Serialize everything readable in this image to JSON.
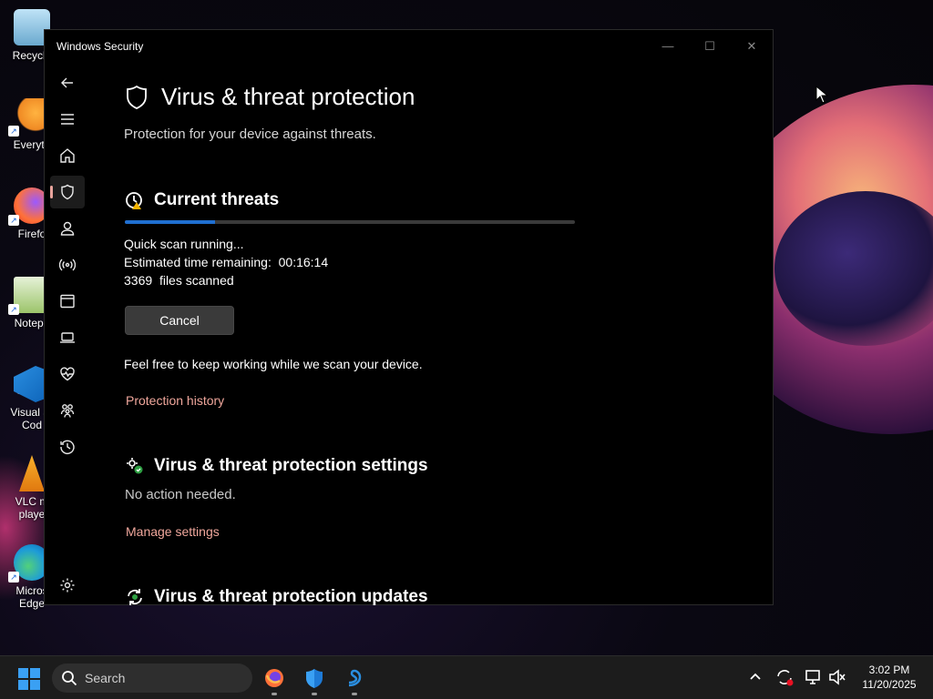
{
  "desktop": {
    "icons": [
      {
        "label": "Recycle",
        "color": "#8fc5e8"
      },
      {
        "label": "Everyth",
        "color": "#f08a24"
      },
      {
        "label": "Firefo",
        "color": "#ff7139"
      },
      {
        "label": "Notepa",
        "color": "#7bb04a"
      },
      {
        "label": "Visual St\nCod",
        "color": "#2a8ee0"
      },
      {
        "label": "VLC m\nplaye",
        "color": "#f29b1a"
      },
      {
        "label": "Micros\nEdge",
        "color": "#1d9bd8"
      }
    ]
  },
  "window": {
    "title": "Windows Security",
    "controls": {
      "minimize": "—",
      "maximize": "☐",
      "close": "✕"
    }
  },
  "sidebar": {
    "selected": "virus-threat",
    "accent": "#e9a59d"
  },
  "page": {
    "title": "Virus & threat protection",
    "subtitle": "Protection for your device against threats."
  },
  "current_threats": {
    "heading": "Current threats",
    "progress": 0.2,
    "status": "Quick scan running...",
    "eta_label": "Estimated time remaining:",
    "eta_value": "00:16:14",
    "files_count": "3369",
    "files_label": "files scanned",
    "cancel_label": "Cancel",
    "note": "Feel free to keep working while we scan your device.",
    "history_link": "Protection history"
  },
  "settings_section": {
    "heading": "Virus & threat protection settings",
    "status": "No action needed.",
    "manage_link": "Manage settings"
  },
  "updates_section": {
    "heading": "Virus & threat protection updates"
  },
  "taskbar": {
    "search_placeholder": "Search",
    "time": "3:02 PM",
    "date": "11/20/2025"
  },
  "colors": {
    "link": "#f0a79c",
    "progress_fill": "#1f6fd1",
    "start_blue": "#3aa0f3"
  }
}
